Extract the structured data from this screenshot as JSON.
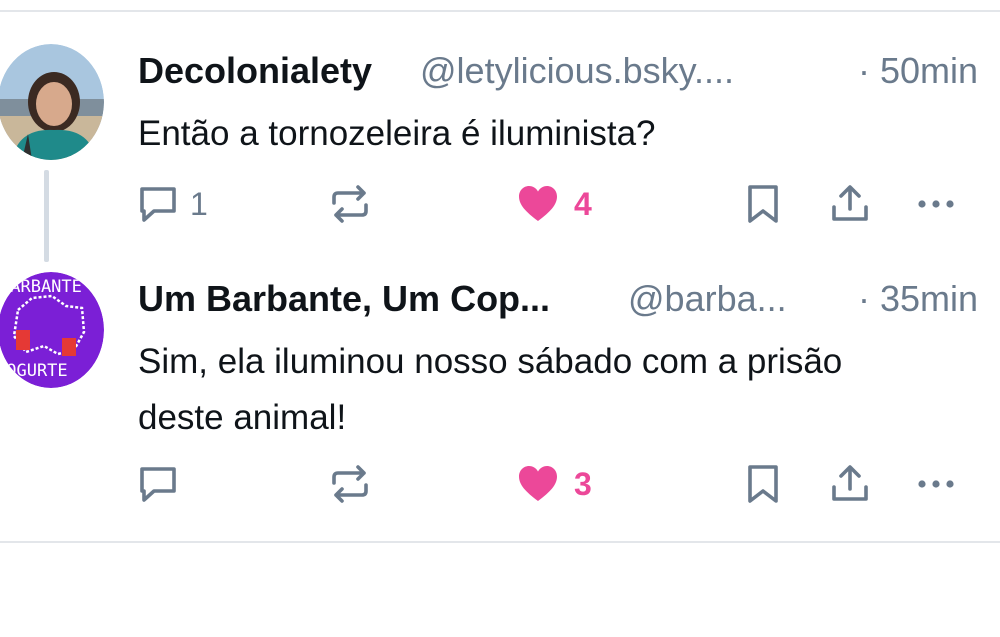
{
  "posts": [
    {
      "display_name": "Decolonialety",
      "handle": "@letylicious.bsky....",
      "time": "· 50min",
      "text": "Então a tornozeleira é iluminista?",
      "reply_count": "1",
      "like_count": "4"
    },
    {
      "display_name": "Um Barbante, Um Cop...",
      "handle": "@barba...",
      "time": "· 35min",
      "text": "Sim, ela iluminou nosso sábado com a prisão deste animal!",
      "reply_count": "",
      "like_count": "3",
      "avatar_text_top": "BARBANTE",
      "avatar_text_bottom": "IOGURTE"
    }
  ],
  "icons": {
    "reply": "comment-icon",
    "repost": "repost-icon",
    "like": "heart-icon",
    "bookmark": "bookmark-icon",
    "share": "share-icon",
    "more": "more-icon"
  },
  "colors": {
    "text": "#0f1419",
    "muted": "#6a7a8c",
    "like": "#ec4899",
    "avatar2_bg": "#7b1fd6"
  }
}
